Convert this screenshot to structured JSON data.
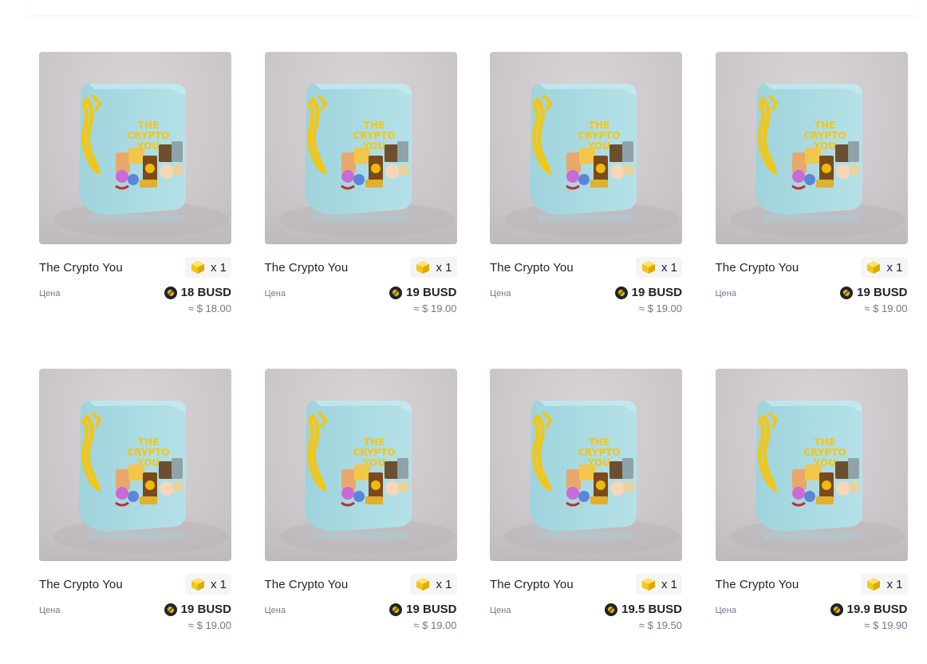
{
  "colors": {
    "text_primary": "#1e2329",
    "text_secondary": "#707a8a",
    "badge_bg": "#f5f5f5",
    "busd_coin": "#f0b90b",
    "box_yellow": "#f3c613",
    "box_body": "#a7d8e0"
  },
  "icons": {
    "quantity": "mystery-box-icon",
    "currency": "busd-coin-icon"
  },
  "cards": [
    {
      "name": "The Crypto You",
      "quantity": "x 1",
      "price_label": "Цена",
      "price": "18 BUSD",
      "price_usd": "≈ $ 18.00"
    },
    {
      "name": "The Crypto You",
      "quantity": "x 1",
      "price_label": "Цена",
      "price": "19 BUSD",
      "price_usd": "≈ $ 19.00"
    },
    {
      "name": "The Crypto You",
      "quantity": "x 1",
      "price_label": "Цена",
      "price": "19 BUSD",
      "price_usd": "≈ $ 19.00"
    },
    {
      "name": "The Crypto You",
      "quantity": "x 1",
      "price_label": "Цена",
      "price": "19 BUSD",
      "price_usd": "≈ $ 19.00"
    },
    {
      "name": "The Crypto You",
      "quantity": "x 1",
      "price_label": "Цена",
      "price": "19 BUSD",
      "price_usd": "≈ $ 19.00"
    },
    {
      "name": "The Crypto You",
      "quantity": "x 1",
      "price_label": "Цена",
      "price": "19 BUSD",
      "price_usd": "≈ $ 19.00"
    },
    {
      "name": "The Crypto You",
      "quantity": "x 1",
      "price_label": "Цена",
      "price": "19.5 BUSD",
      "price_usd": "≈ $ 19.50"
    },
    {
      "name": "The Crypto You",
      "quantity": "x 1",
      "price_label": "Цена",
      "price": "19.9 BUSD",
      "price_usd": "≈ $ 19.90"
    }
  ]
}
